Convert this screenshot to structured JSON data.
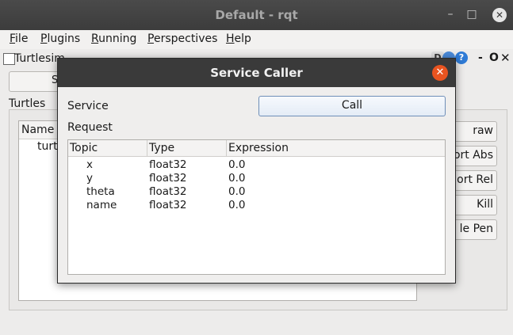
{
  "window": {
    "title": "Default - rqt",
    "minimize": "–",
    "maximize": "□",
    "close": "✕"
  },
  "menu": [
    {
      "first": "F",
      "rest": "ile"
    },
    {
      "first": "P",
      "rest": "lugins"
    },
    {
      "first": "R",
      "rest": "unning"
    },
    {
      "first": "P",
      "rest": "erspectives"
    },
    {
      "first": "H",
      "rest": "elp"
    }
  ],
  "plugin": {
    "title": "Turtlesim",
    "d_label": "D",
    "help_label": "?",
    "dash": "-",
    "o": "O",
    "x": "✕"
  },
  "background": {
    "top_button_fragment": "S",
    "turtles_label": "Turtles",
    "tree_header": "Name",
    "tree_item_fragment": "turt",
    "right_buttons": [
      "raw",
      "ort Abs",
      "ort Rel",
      "Kill",
      "le Pen"
    ]
  },
  "dialog": {
    "title": "Service Caller",
    "close": "✕",
    "service_label": "Service",
    "call_button": "Call",
    "request_label": "Request",
    "columns": [
      "Topic",
      "Type",
      "Expression"
    ],
    "rows": [
      {
        "topic": "x",
        "type": "float32",
        "expression": "0.0"
      },
      {
        "topic": "y",
        "type": "float32",
        "expression": "0.0"
      },
      {
        "topic": "theta",
        "type": "float32",
        "expression": "0.0"
      },
      {
        "topic": "name",
        "type": "float32",
        "expression": "0.0"
      }
    ]
  }
}
